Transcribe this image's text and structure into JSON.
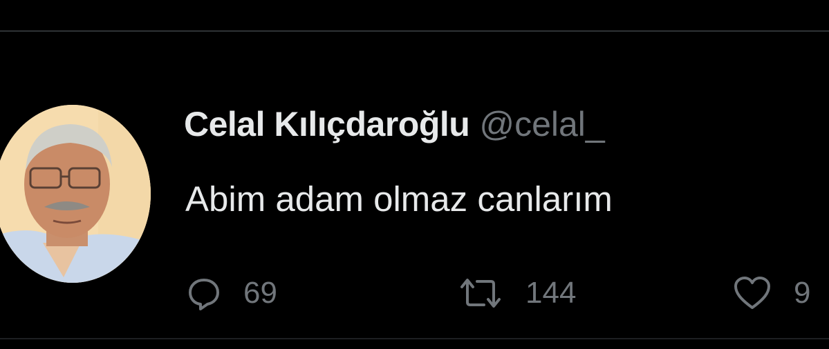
{
  "tweet": {
    "author": {
      "display_name": "Celal Kılıçdaroğlu",
      "handle": "@celal_"
    },
    "text": "Abim adam olmaz canlarım",
    "actions": {
      "reply": {
        "icon": "reply-icon",
        "count": "69"
      },
      "retweet": {
        "icon": "retweet-icon",
        "count": "144"
      },
      "like": {
        "icon": "heart-icon",
        "count": "9"
      }
    }
  },
  "colors": {
    "background": "#000000",
    "primary_text": "#e7e9ea",
    "secondary_text": "#71767b",
    "divider": "#2f3336"
  }
}
